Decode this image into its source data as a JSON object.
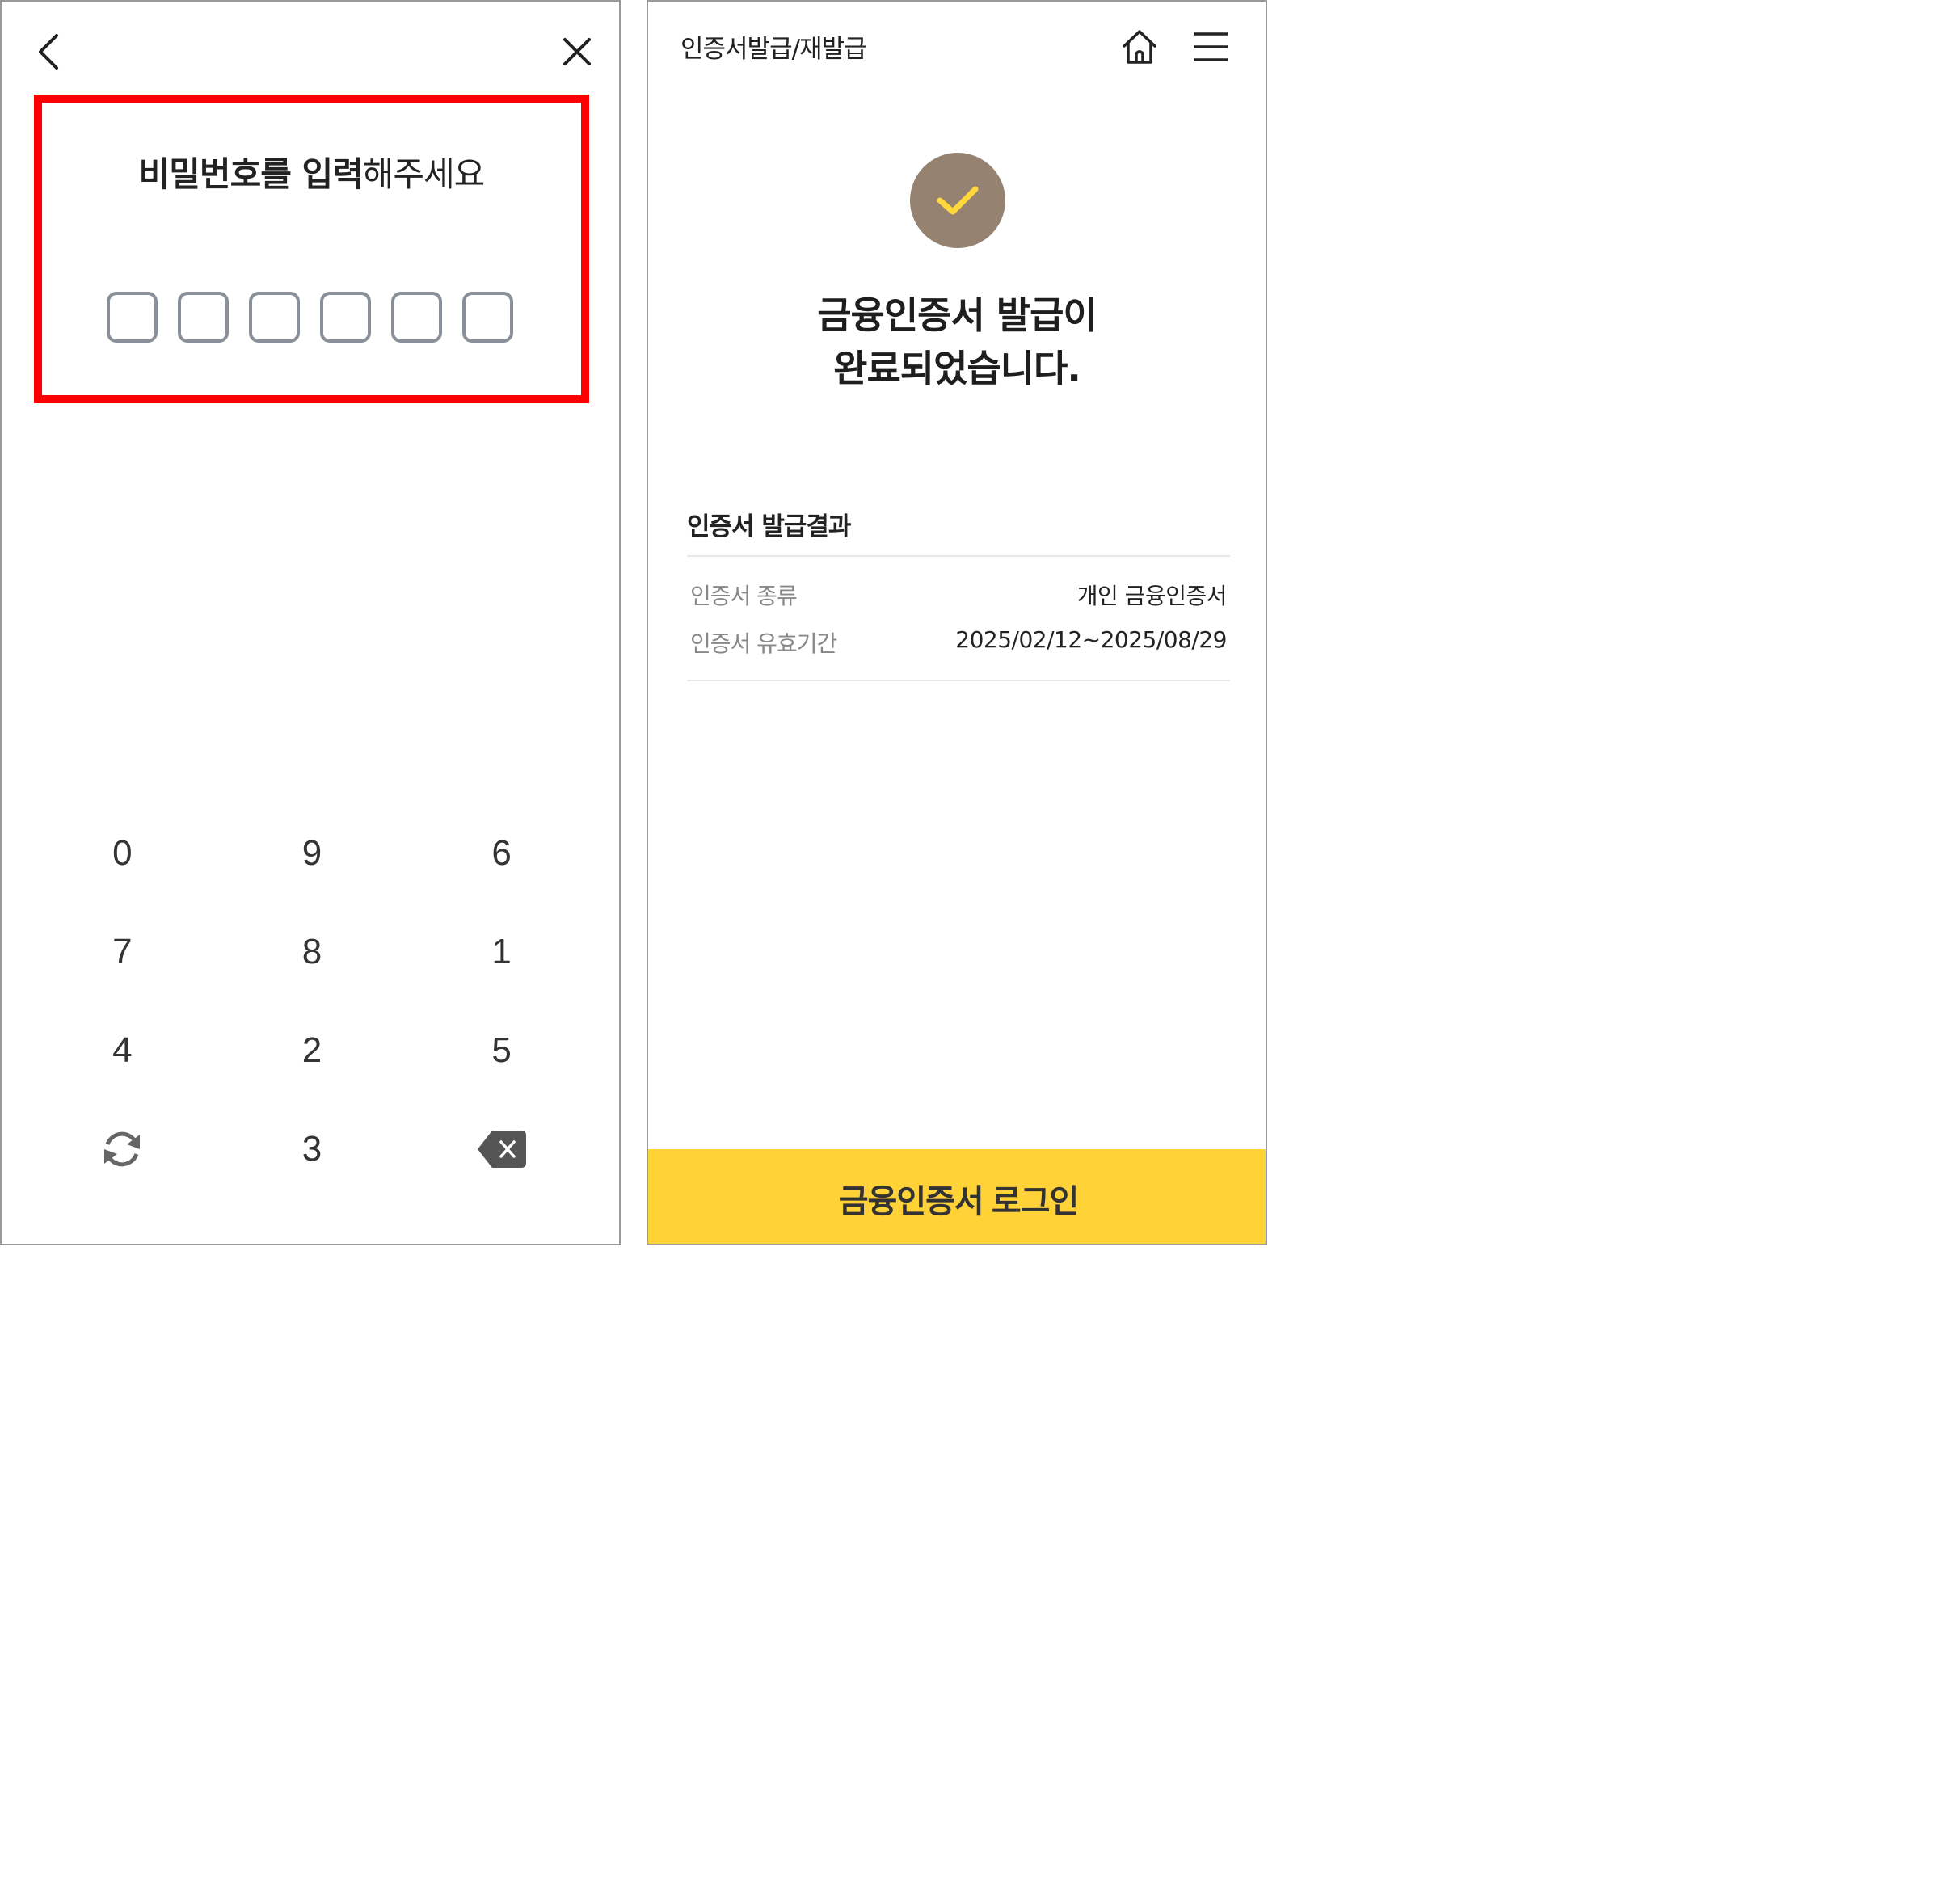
{
  "left_screen": {
    "icons": {
      "back": "chevron-left-icon",
      "close": "close-icon",
      "refresh": "refresh-icon",
      "backspace": "backspace-icon"
    },
    "pin_prompt": {
      "bold": "비밀번호를 입력",
      "normal": "해주세요"
    },
    "pin_length": 6,
    "keypad": [
      "0",
      "9",
      "6",
      "7",
      "8",
      "1",
      "4",
      "2",
      "5",
      "refresh",
      "3",
      "backspace"
    ],
    "highlight_color": "#ff0000"
  },
  "right_screen": {
    "header": {
      "title": "인증서발급/재발급"
    },
    "icons": {
      "home": "home-icon",
      "menu": "hamburger-menu-icon",
      "check": "checkmark-icon"
    },
    "completion": {
      "line1": "금융인증서 발급이",
      "line2": "완료되었습니다."
    },
    "result": {
      "title": "인증서 발급결과",
      "rows": [
        {
          "label": "인증서 종류",
          "value": "개인 금융인증서"
        },
        {
          "label": "인증서 유효기간",
          "value": "2025/02/12~2025/08/29"
        }
      ]
    },
    "login_button": "금융인증서 로그인",
    "colors": {
      "check_bg": "#958270",
      "check_mark": "#ffd83c",
      "button_bg": "#ffd338"
    }
  }
}
